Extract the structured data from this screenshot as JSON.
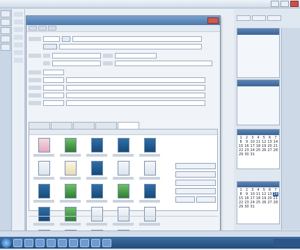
{
  "window": {
    "title": "",
    "app_label": ""
  },
  "dialog": {
    "title": ""
  },
  "form": {
    "address_line": "",
    "postal_code": ""
  },
  "tabs": [
    "",
    "",
    "",
    "",
    ""
  ],
  "image_panel": {
    "header": "",
    "thumbnails": [
      {
        "tone": "pink",
        "caption": ""
      },
      {
        "tone": "green",
        "caption": ""
      },
      {
        "tone": "blue",
        "caption": ""
      },
      {
        "tone": "blue",
        "caption": ""
      },
      {
        "tone": "blue",
        "caption": ""
      },
      {
        "tone": "light",
        "caption": ""
      },
      {
        "tone": "cream",
        "caption": ""
      },
      {
        "tone": "blue",
        "caption": ""
      },
      {
        "tone": "light",
        "caption": ""
      },
      {
        "tone": "light",
        "caption": ""
      },
      {
        "tone": "blue",
        "caption": ""
      },
      {
        "tone": "green",
        "caption": ""
      },
      {
        "tone": "blue",
        "caption": ""
      },
      {
        "tone": "green",
        "caption": ""
      },
      {
        "tone": "blue",
        "caption": ""
      },
      {
        "tone": "blue",
        "caption": ""
      },
      {
        "tone": "green",
        "caption": ""
      },
      {
        "tone": "light",
        "caption": ""
      },
      {
        "tone": "light",
        "caption": ""
      },
      {
        "tone": "light",
        "caption": ""
      },
      {
        "tone": "pink",
        "caption": ""
      },
      {
        "tone": "green",
        "caption": ""
      },
      {
        "tone": "green",
        "caption": ""
      },
      {
        "tone": "yellow",
        "caption": ""
      }
    ]
  },
  "calendar": {
    "month_1_label": "",
    "month_2_label": "",
    "days": [
      1,
      2,
      3,
      4,
      5,
      6,
      7,
      8,
      9,
      10,
      11,
      12,
      13,
      14,
      15,
      16,
      17,
      18,
      19,
      20,
      21,
      22,
      23,
      24,
      25,
      26,
      27,
      28,
      29,
      30,
      31
    ],
    "today": 14
  },
  "colors": {
    "title_bar": "#4b77ab",
    "close_button": "#cf5a50",
    "taskbar": "#234b79"
  }
}
